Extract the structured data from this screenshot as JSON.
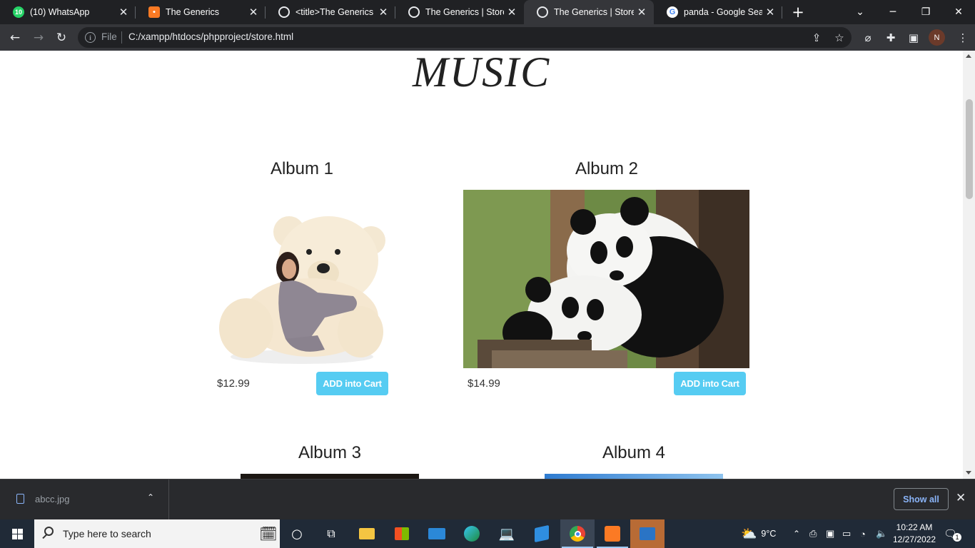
{
  "browser": {
    "tabs": [
      {
        "title": "(10) WhatsApp",
        "icon": "whatsapp-icon",
        "badge": "10"
      },
      {
        "title": "The Generics",
        "icon": "xampp-icon"
      },
      {
        "title": "<title>The Generics",
        "icon": "globe-icon"
      },
      {
        "title": "The Generics | Store",
        "icon": "globe-icon"
      },
      {
        "title": "The Generics | Store",
        "icon": "globe-icon",
        "active": true
      },
      {
        "title": "panda - Google Search",
        "icon": "google-icon"
      }
    ],
    "address": {
      "scheme_label": "File",
      "url": "C:/xampp/htdocs/phpproject/store.html"
    },
    "profile_initial": "N"
  },
  "page": {
    "section_title": "MUSIC",
    "albums": [
      {
        "title": "Album 1",
        "price": "$12.99",
        "button": "ADD into Cart",
        "image": "teddy-bear-image"
      },
      {
        "title": "Album 2",
        "price": "$14.99",
        "button": "ADD into Cart",
        "image": "panda-image"
      },
      {
        "title": "Album 3",
        "image": "album3-image"
      },
      {
        "title": "Album 4",
        "image": "album4-image"
      }
    ],
    "accent_color": "#56ccf2"
  },
  "downloads": {
    "file_name": "abcc.jpg",
    "show_all": "Show all"
  },
  "taskbar": {
    "search_placeholder": "Type here to search",
    "weather": "9°C",
    "time": "10:22 AM",
    "date": "12/27/2022",
    "notification_count": "1"
  }
}
